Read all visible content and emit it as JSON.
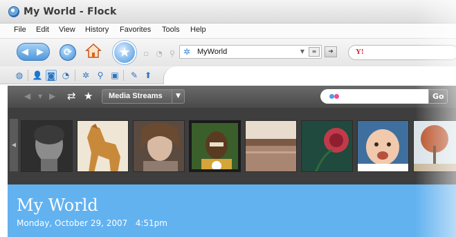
{
  "window": {
    "title": "My World - Flock"
  },
  "menu": {
    "items": [
      "File",
      "Edit",
      "View",
      "History",
      "Favorites",
      "Tools",
      "Help"
    ]
  },
  "navbar": {
    "url": "MyWorld",
    "search_engine": "Y!"
  },
  "mediabar": {
    "streams_label": "Media Streams",
    "go_label": "Go"
  },
  "photos": [
    {
      "subject": "portrait of a man"
    },
    {
      "subject": "horse"
    },
    {
      "subject": "young woman"
    },
    {
      "subject": "boy with painted face"
    },
    {
      "subject": "river at sunset"
    },
    {
      "subject": "red rose"
    },
    {
      "subject": "baby"
    },
    {
      "subject": "autumn tree"
    }
  ],
  "page": {
    "heading": "My World",
    "date": "Monday, October 29, 2007",
    "time": "4:51pm"
  },
  "colors": {
    "banner": "#62b2f0",
    "mediabar": "#4a4a4a"
  }
}
